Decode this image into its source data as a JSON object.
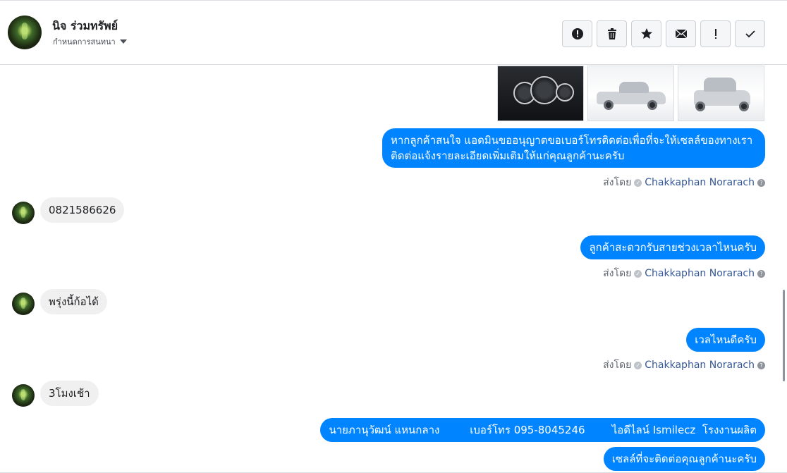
{
  "header": {
    "contact_name": "นิจ ร่วมทรัพย์",
    "assign_label": "กำหนดการสนทนา",
    "actions": [
      {
        "name": "report-spam-button",
        "icon": "exclamation-circle-icon"
      },
      {
        "name": "delete-button",
        "icon": "trash-icon"
      },
      {
        "name": "star-button",
        "icon": "star-icon"
      },
      {
        "name": "mark-unread-button",
        "icon": "envelope-icon"
      },
      {
        "name": "follow-up-button",
        "icon": "exclamation-icon"
      },
      {
        "name": "mark-done-button",
        "icon": "check-icon"
      }
    ]
  },
  "thread": {
    "messages": [
      {
        "type": "out",
        "text_line1": "หากลูกค้าสนใจ แอดมินขออนุญาตขอเบอร์โทรติดต่อเพื่อที่จะให้เซลล์ของทางเรา",
        "text_line2": "ติดต่อแจ้งรายละเอียดเพิ่มเติมให้แก่คุณลูกค้านะครับ"
      },
      {
        "type": "in",
        "text": "0821586626"
      },
      {
        "type": "out",
        "text": "ลูกค้าสะดวกรับสายช่วงเวลาไหนครับ"
      },
      {
        "type": "in",
        "text": "พรุ่งนี้ก้อได้"
      },
      {
        "type": "out",
        "text": "เวลไหนดีครับ"
      },
      {
        "type": "in",
        "text": "3โมงเช้า"
      },
      {
        "type": "out",
        "text": "นายภานุวัฒน์ แหนกลาง         เบอร์โทร 095-8045246        ไอดีไลน์ Ismilecz  โรงงานผลิต"
      },
      {
        "type": "out",
        "text": "เซลล์ที่จะติดต่อคุณลูกค้านะครับ"
      }
    ],
    "sent_by_label": "ส่งโดย",
    "sender_name": "Chakkaphan Norarach",
    "help_glyph": "?"
  },
  "colors": {
    "outgoing_bubble": "#0084ff",
    "incoming_bubble": "#f1f0f0",
    "sender_link": "#365899"
  }
}
